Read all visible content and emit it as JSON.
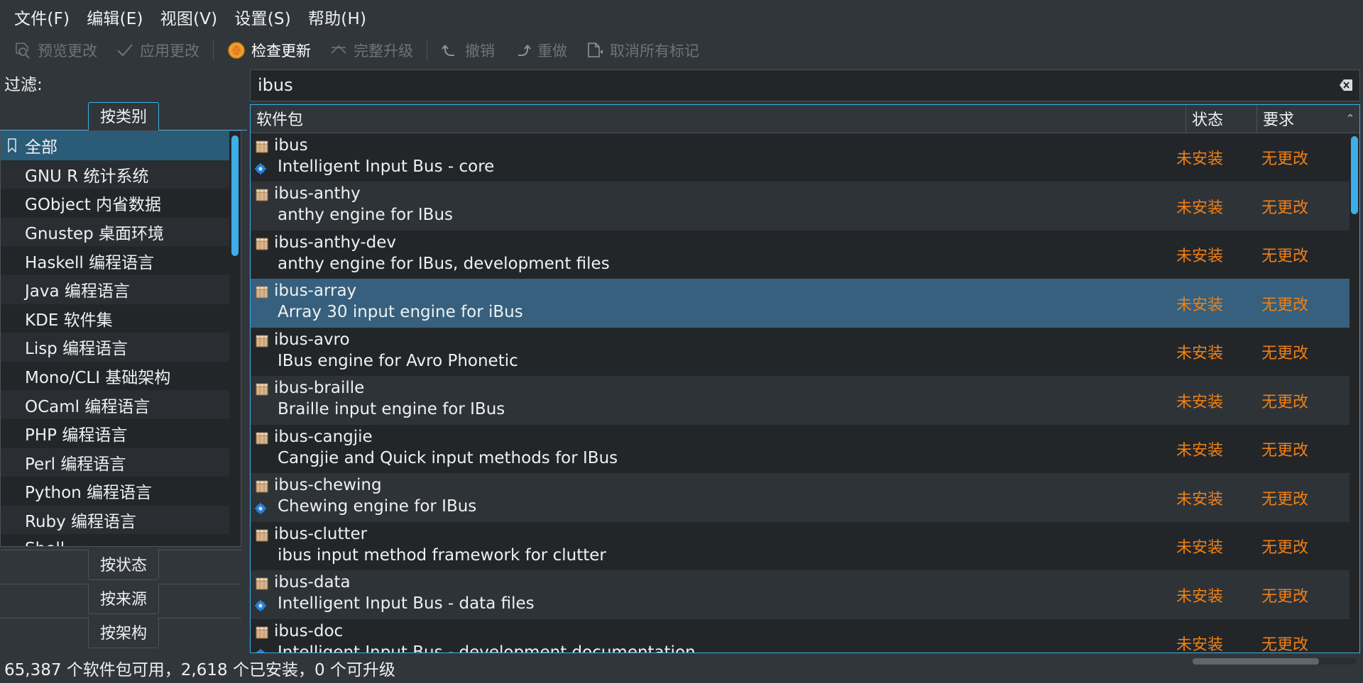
{
  "menubar": {
    "items": [
      {
        "label": "文件(F)",
        "name": "menu-file"
      },
      {
        "label": "编辑(E)",
        "name": "menu-edit"
      },
      {
        "label": "视图(V)",
        "name": "menu-view"
      },
      {
        "label": "设置(S)",
        "name": "menu-settings"
      },
      {
        "label": "帮助(H)",
        "name": "menu-help"
      }
    ]
  },
  "toolbar": {
    "preview_changes": "预览更改",
    "apply_changes": "应用更改",
    "check_updates": "检查更新",
    "full_upgrade": "完整升级",
    "undo": "撤销",
    "redo": "重做",
    "unmark_all": "取消所有标记"
  },
  "filter": {
    "label": "过滤:",
    "tab_category": "按类别",
    "categories": [
      {
        "label": "全部",
        "icon": "bookmark-icon",
        "selected": true
      },
      {
        "label": "GNU R 统计系统",
        "selected": false
      },
      {
        "label": "GObject 内省数据",
        "selected": false
      },
      {
        "label": "Gnustep 桌面环境",
        "selected": false
      },
      {
        "label": "Haskell 编程语言",
        "selected": false
      },
      {
        "label": "Java 编程语言",
        "selected": false
      },
      {
        "label": "KDE 软件集",
        "selected": false
      },
      {
        "label": "Lisp 编程语言",
        "selected": false
      },
      {
        "label": "Mono/CLI 基础架构",
        "selected": false
      },
      {
        "label": "OCaml 编程语言",
        "selected": false
      },
      {
        "label": "PHP 编程语言",
        "selected": false
      },
      {
        "label": "Perl 编程语言",
        "selected": false
      },
      {
        "label": "Python 编程语言",
        "selected": false
      },
      {
        "label": "Ruby 编程语言",
        "selected": false
      },
      {
        "label": "Shell",
        "selected": false
      }
    ],
    "bottom_tabs": [
      {
        "label": "按状态",
        "name": "tab-by-status"
      },
      {
        "label": "按来源",
        "name": "tab-by-origin"
      },
      {
        "label": "按架构",
        "name": "tab-by-architecture"
      }
    ]
  },
  "search": {
    "value": "ibus",
    "placeholder": "",
    "clear_icon": "clear-icon"
  },
  "table": {
    "headers": {
      "package": "软件包",
      "status": "状态",
      "requirement": "要求",
      "sort_indicator": "⌃"
    },
    "rows": [
      {
        "name": "ibus",
        "desc": "Intelligent Input Bus - core",
        "status": "未安装",
        "req": "无更改",
        "gear": true,
        "selected": false
      },
      {
        "name": "ibus-anthy",
        "desc": "anthy engine for IBus",
        "status": "未安装",
        "req": "无更改",
        "gear": false,
        "selected": false
      },
      {
        "name": "ibus-anthy-dev",
        "desc": "anthy engine for IBus, development files",
        "status": "未安装",
        "req": "无更改",
        "gear": false,
        "selected": false
      },
      {
        "name": "ibus-array",
        "desc": "Array 30 input engine for iBus",
        "status": "未安装",
        "req": "无更改",
        "gear": false,
        "selected": true
      },
      {
        "name": "ibus-avro",
        "desc": "IBus engine for Avro Phonetic",
        "status": "未安装",
        "req": "无更改",
        "gear": false,
        "selected": false
      },
      {
        "name": "ibus-braille",
        "desc": "Braille input engine for IBus",
        "status": "未安装",
        "req": "无更改",
        "gear": false,
        "selected": false
      },
      {
        "name": "ibus-cangjie",
        "desc": "Cangjie and Quick input methods for IBus",
        "status": "未安装",
        "req": "无更改",
        "gear": false,
        "selected": false
      },
      {
        "name": "ibus-chewing",
        "desc": "Chewing engine for IBus",
        "status": "未安装",
        "req": "无更改",
        "gear": true,
        "selected": false
      },
      {
        "name": "ibus-clutter",
        "desc": "ibus input method framework for clutter",
        "status": "未安装",
        "req": "无更改",
        "gear": false,
        "selected": false
      },
      {
        "name": "ibus-data",
        "desc": "Intelligent Input Bus - data files",
        "status": "未安装",
        "req": "无更改",
        "gear": true,
        "selected": false
      },
      {
        "name": "ibus-doc",
        "desc": "Intelligent Input Bus - development documentation",
        "status": "未安装",
        "req": "无更改",
        "gear": true,
        "selected": false
      }
    ]
  },
  "statusbar": {
    "text": "65,387 个软件包可用，2,618 个已安装，0 个可升级"
  },
  "colors": {
    "accent": "#3daee9",
    "status_orange": "#ee8019",
    "selection": "#36607d",
    "window_bg": "#31363b",
    "view_bg": "#232629"
  }
}
